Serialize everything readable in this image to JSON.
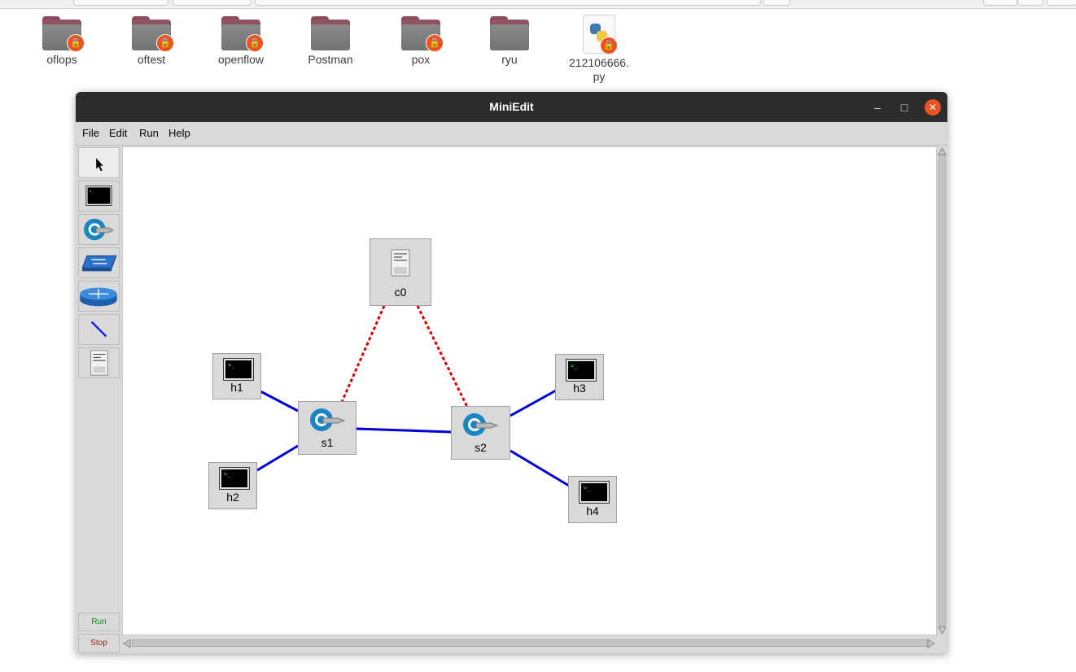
{
  "desktop": {
    "items": [
      {
        "label": "oflops",
        "type": "folder",
        "locked": true
      },
      {
        "label": "oftest",
        "type": "folder",
        "locked": true
      },
      {
        "label": "openflow",
        "type": "folder",
        "locked": true
      },
      {
        "label": "Postman",
        "type": "folder",
        "locked": false
      },
      {
        "label": "pox",
        "type": "folder",
        "locked": true
      },
      {
        "label": "ryu",
        "type": "folder",
        "locked": false
      },
      {
        "label": "212106666.\npy",
        "type": "python-file",
        "locked": true
      }
    ]
  },
  "window": {
    "title": "MiniEdit",
    "controls": {
      "minimize": "–",
      "maximize": "□",
      "close": "✕"
    }
  },
  "menubar": {
    "file": "File",
    "edit": "Edit",
    "run": "Run",
    "help": "Help"
  },
  "toolbar": {
    "tools": [
      "select-tool",
      "host-tool",
      "switch-tool",
      "legacy-switch-tool",
      "legacy-router-tool",
      "netlink-tool",
      "controller-tool"
    ],
    "run_label": "Run",
    "stop_label": "Stop"
  },
  "topology": {
    "controller": {
      "label": "c0"
    },
    "switches": [
      {
        "label": "s1"
      },
      {
        "label": "s2"
      }
    ],
    "hosts": [
      {
        "label": "h1"
      },
      {
        "label": "h2"
      },
      {
        "label": "h3"
      },
      {
        "label": "h4"
      }
    ],
    "links": [
      [
        "h1",
        "s1"
      ],
      [
        "h2",
        "s1"
      ],
      [
        "s1",
        "s2"
      ],
      [
        "s2",
        "h3"
      ],
      [
        "s2",
        "h4"
      ]
    ],
    "controller_links": [
      [
        "c0",
        "s1"
      ],
      [
        "c0",
        "s2"
      ]
    ]
  },
  "colors": {
    "link": "#0000dd",
    "controller_link": "#dd0000",
    "close_button": "#e95420",
    "titlebar": "#2c2c2c"
  }
}
